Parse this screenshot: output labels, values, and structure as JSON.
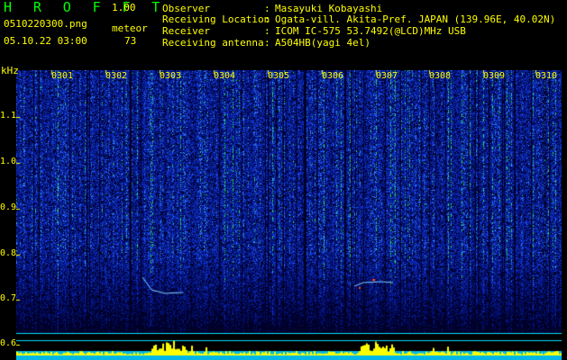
{
  "header": {
    "app_title": "H R O F F T",
    "version": "1.00",
    "filename": "0510220300.png",
    "datetime": "05.10.22 03:00",
    "meteor_label": "meteor",
    "meteor_count": "73"
  },
  "station_info": [
    {
      "label": "Observer",
      "value": "Masayuki Kobayashi"
    },
    {
      "label": "Receiving Location",
      "value": "Ogata-vill. Akita-Pref. JAPAN (139.96E, 40.02N)"
    },
    {
      "label": "Receiver",
      "value": "ICOM IC-575 53.7492(@LCD)MHz USB"
    },
    {
      "label": "Receiving antenna",
      "value": "A504HB(yagi 4el)"
    }
  ],
  "colon": ":",
  "spectrogram": {
    "y_unit": "kHz",
    "y_ticks": [
      "1.1",
      "1.0",
      "0.9",
      "0.8",
      "0.7",
      "0.6"
    ],
    "x_ticks": [
      "0301",
      "0302",
      "0303",
      "0304",
      "0305",
      "0306",
      "0307",
      "0308",
      "0309",
      "0310"
    ],
    "colors": {
      "background_noise": "#0a1a8c",
      "noise_high": "#2f6cff",
      "echo": "#22ff66",
      "tick": "#ffff00",
      "baseline": "#00e0ff",
      "power_bar": "#ffff00"
    }
  }
}
